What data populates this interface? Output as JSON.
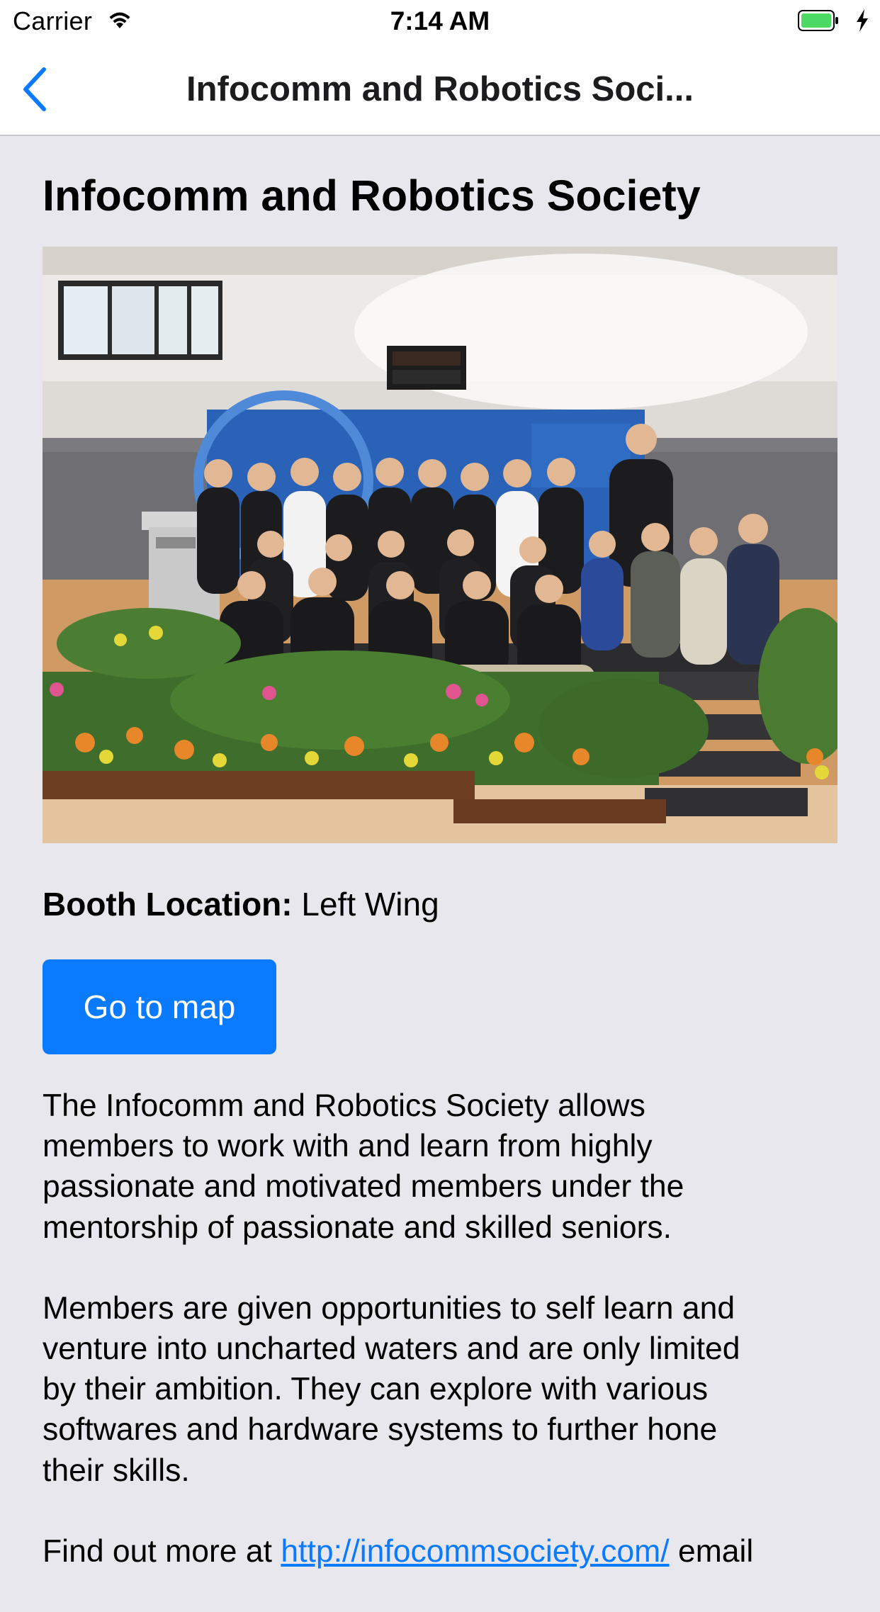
{
  "status_bar": {
    "carrier": "Carrier",
    "time": "7:14 AM",
    "icons": [
      "wifi-icon",
      "battery-icon",
      "charging-icon"
    ],
    "battery_color": "#4cd964"
  },
  "nav_bar": {
    "back_icon": "chevron-left-icon",
    "title": "Infocomm and Robotics Soci..."
  },
  "society": {
    "name": "Infocomm and Robotics Society",
    "booth_label": "Booth Location:",
    "booth_value": " Left Wing",
    "map_button_label": "Go to map",
    "description": {
      "paragraph_1": [
        "The Infocomm and Robotics Society allows",
        "members to work with and learn from highly",
        "passionate and motivated members under the",
        "mentorship of passionate and skilled seniors."
      ],
      "paragraph_2": [
        "Members are given opportunities to self learn and",
        "venture into uncharted waters and are only limited",
        "by their ambition. They can explore with various",
        "softwares and hardware systems to further hone",
        "their skills."
      ],
      "find_out_prefix": "Find out more at ",
      "link_text": "http://infocommsociety.com/",
      "find_out_suffix": " email"
    }
  },
  "colors": {
    "accent": "#0a7bff",
    "background": "#e8e7ed",
    "nav_background": "#ffffff"
  }
}
